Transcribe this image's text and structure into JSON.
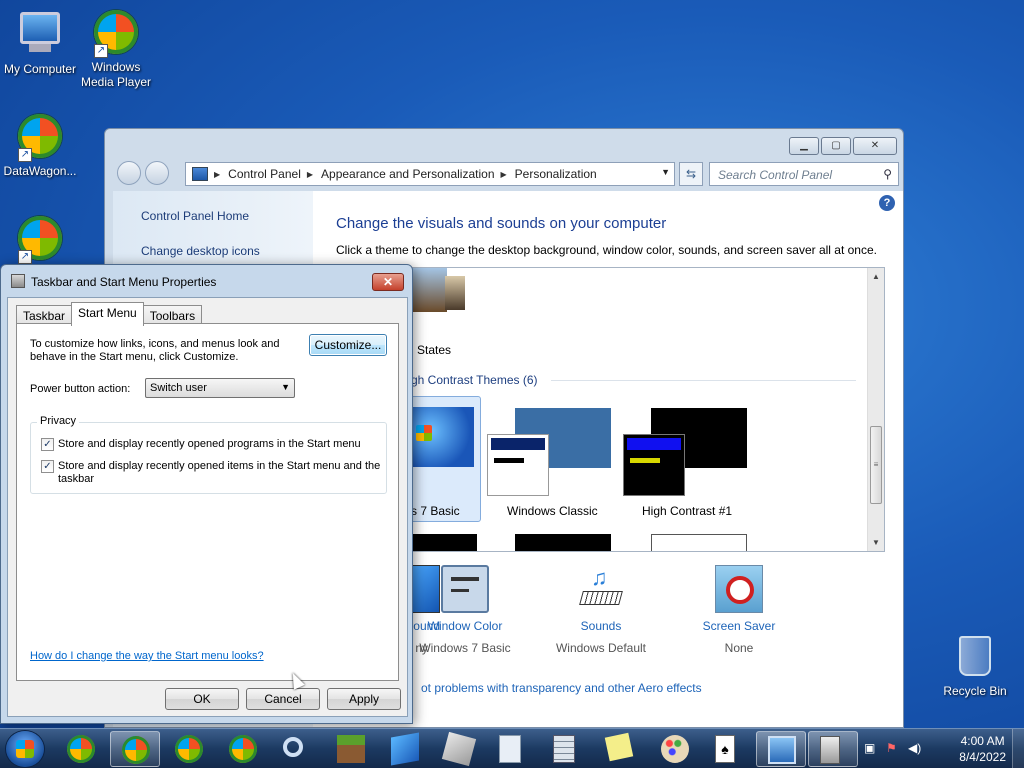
{
  "desktop": {
    "icons": [
      {
        "label": "My Computer"
      },
      {
        "label": "Windows Media Player"
      },
      {
        "label": "DataWagon..."
      },
      {
        "label": ""
      },
      {
        "label": "Recycle Bin"
      }
    ]
  },
  "control_panel": {
    "breadcrumb": [
      "Control Panel",
      "Appearance and Personalization",
      "Personalization"
    ],
    "search_placeholder": "Search Control Panel",
    "left_links": [
      "Control Panel Home",
      "Change desktop icons"
    ],
    "title": "Change the visuals and sounds on your computer",
    "subtitle": "Click a theme to change the desktop background, window color, sounds, and screen saver all at once.",
    "themes": {
      "partial_theme_label": "States",
      "group_title": "gh Contrast Themes (6)",
      "items": [
        {
          "label": "s 7 Basic",
          "selected": true
        },
        {
          "label": "Windows Classic"
        },
        {
          "label": "High Contrast #1"
        }
      ]
    },
    "bottom_items": [
      {
        "title": "kground",
        "value": "ny"
      },
      {
        "title": "Window Color",
        "value": "Windows 7 Basic"
      },
      {
        "title": "Sounds",
        "value": "Windows Default"
      },
      {
        "title": "Screen Saver",
        "value": "None"
      }
    ],
    "aero_link": "ot problems with transparency and other Aero effects"
  },
  "dialog": {
    "title": "Taskbar and Start Menu Properties",
    "close_label": "✕",
    "tabs": [
      "Taskbar",
      "Start Menu",
      "Toolbars"
    ],
    "active_tab": "Start Menu",
    "description": "To customize how links, icons, and menus look and behave in the Start menu, click Customize.",
    "customize_label": "Customize...",
    "power_button_label": "Power button action:",
    "power_button_value": "Switch user",
    "privacy_legend": "Privacy",
    "privacy_options": [
      {
        "label": "Store and display recently opened programs in the Start menu",
        "checked": true
      },
      {
        "label": "Store and display recently opened items in the Start menu and the taskbar",
        "checked": true
      }
    ],
    "help_link": "How do I change the way the Start menu looks?",
    "buttons": {
      "ok": "OK",
      "cancel": "Cancel",
      "apply": "Apply"
    }
  },
  "taskbar": {
    "time": "4:00 AM",
    "date": "8/4/2022"
  }
}
